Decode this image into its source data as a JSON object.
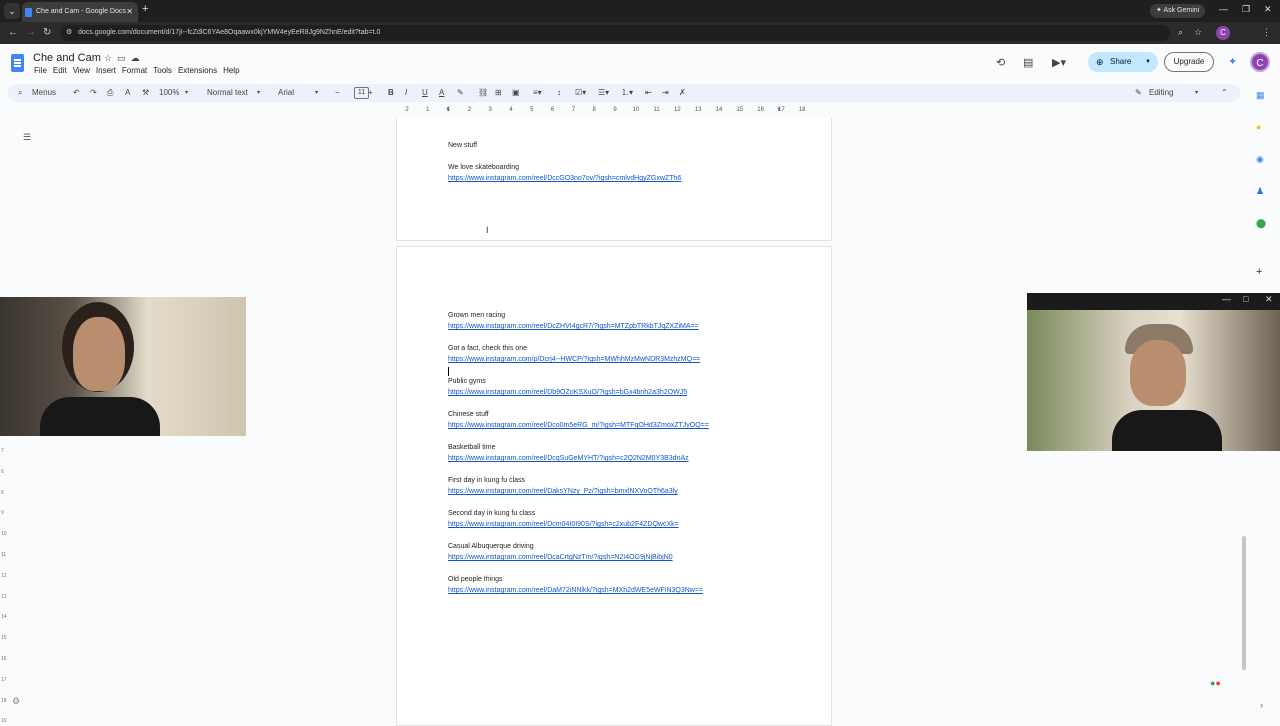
{
  "browser": {
    "tab_title": "Che and Cam - Google Docs",
    "url": "docs.google.com/document/d/17jI--fcZdlC6YAe8Oqaawx0kjYMW4eyEeR8Jg9NZhnE/edit?tab=t.0",
    "gemini_label": "Ask Gemini",
    "profile_initial": "C"
  },
  "doc": {
    "title": "Che and Cam",
    "menus": [
      "File",
      "Edit",
      "View",
      "Insert",
      "Format",
      "Tools",
      "Extensions",
      "Help"
    ],
    "share_label": "Share",
    "upgrade_label": "Upgrade",
    "avatar_initial": "C"
  },
  "toolbar": {
    "search_label": "Menus",
    "zoom": "100%",
    "style": "Normal text",
    "font": "Arial",
    "font_size": "11",
    "mode": "Editing"
  },
  "ruler": {
    "labels": [
      "2",
      "1",
      "1",
      "2",
      "3",
      "4",
      "5",
      "6",
      "7",
      "8",
      "9",
      "10",
      "11",
      "12",
      "13",
      "14",
      "15",
      "16",
      "17",
      "18"
    ],
    "vertical_labels": [
      "7",
      "6",
      "8",
      "9",
      "10",
      "11",
      "12",
      "13",
      "14",
      "15",
      "16",
      "17",
      "18",
      "19"
    ]
  },
  "content": {
    "page1": {
      "heading": "New stuff",
      "item_title": "We love skateboarding",
      "item_link": "https://www.instagram.com/reel/DccGO3no7ov/?igsh=cmlvdHgyZGxwZTh6"
    },
    "entries": [
      {
        "title": "Grown men racing",
        "link": "https://www.instagram.com/reel/DcZHVI4gcR7/?igsh=MTZpbTRkbTJqZXZiMA=="
      },
      {
        "title": "Got a fact, check this one",
        "link": "https://www.instagram.com/p/Dcrj4--HWCP/?igsh=MWhhMzMwNDR3MzhzMQ=="
      },
      {
        "title": "Public gyms",
        "link": "https://www.instagram.com/reel/Db9OZoKSXuO/?igsh=bGx4bnh2a3h2OWJ5"
      },
      {
        "title": "Chinese stuff",
        "link": "https://www.instagram.com/reel/Dco0m5eRG_m/?igsh=MTFqOHd3ZmoxZTJyOQ=="
      },
      {
        "title": "Basketball time",
        "link": "https://www.instagram.com/reel/DcqSuGeMYHT/?igsh=c2Q2N2M0Y3B3dnAz"
      },
      {
        "title": "First day in kung fu class",
        "link": "https://www.instagram.com/reel/DaksYNzy_Pz/?igsh=bmxlNXVoOTh6a3ly"
      },
      {
        "title": "Second day in kung fu class",
        "link": "https://www.instagram.com/reel/Dcm04I0I90S/?igsh=c2xub2F4ZDQwcXk="
      },
      {
        "title": "Casual Albuquerque driving",
        "link": "https://www.instagram.com/reel/DcaCrtgNzTm/?igsh=N2I4OG9jNjBibjN0"
      },
      {
        "title": "Old people things",
        "link": "https://www.instagram.com/reel/DaM72iNNlkk/?igsh=MXh2dWE5eWFiN3Q3Nw=="
      }
    ]
  },
  "colors": {
    "link": "#1155cc",
    "share_bg": "#c2e7ff",
    "avatar": "#8e44ad",
    "toolbar_bg": "#edf2fa"
  }
}
